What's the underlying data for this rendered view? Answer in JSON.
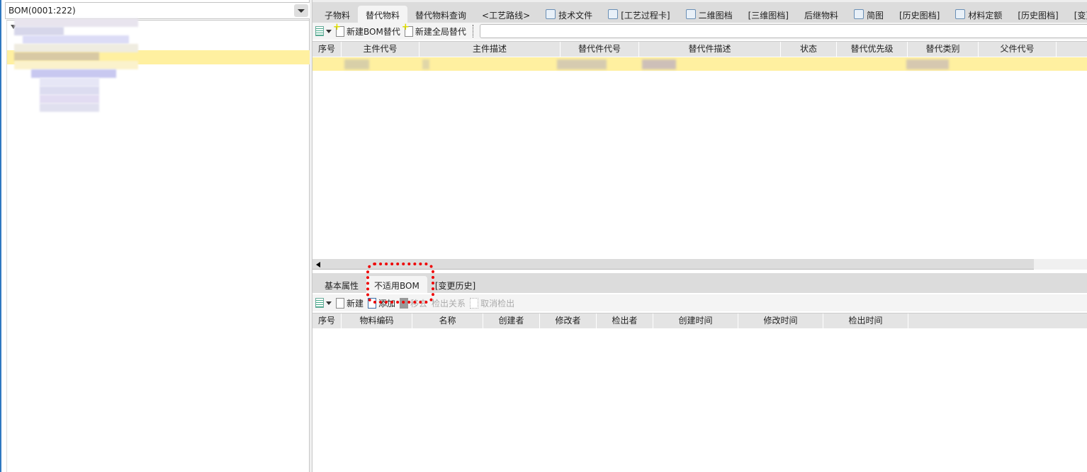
{
  "left": {
    "combo_value": "BOM(0001:222)"
  },
  "top_tabs": [
    "子物料",
    "替代物料",
    "替代物料查询",
    "<工艺路线>",
    "技术文件",
    "[工艺过程卡]",
    "二维图档",
    "[三维图档]",
    "后继物料",
    "简图",
    "[历史图档]",
    "材料定额",
    "[历史图档]",
    "[变更历史"
  ],
  "top_tab_icons": [
    "",
    "",
    "",
    "",
    "document-icon",
    "process-card-icon",
    "2d-drawing-icon",
    "",
    "",
    "sketch-icon",
    "",
    "material-quota-icon",
    "",
    ""
  ],
  "top_active": 1,
  "top_toolbar": {
    "new_bom_sub": "新建BOM替代",
    "new_global_sub": "新建全局替代"
  },
  "top_columns": [
    "序号",
    "主件代号",
    "主件描述",
    "替代件代号",
    "替代件描述",
    "状态",
    "替代优先级",
    "替代类别",
    "父件代号"
  ],
  "bottom_tabs": [
    "基本属性",
    "不适用BOM",
    "[变更历史]"
  ],
  "bottom_active": 1,
  "bottom_toolbar": {
    "new": "新建",
    "add": "添加",
    "remove": "移去",
    "checkout_rel": "检出关系",
    "cancel_checkout": "取消检出"
  },
  "bottom_columns": [
    "序号",
    "物料编码",
    "名称",
    "创建者",
    "修改者",
    "检出者",
    "创建时间",
    "修改时间",
    "检出时间"
  ],
  "colors": {
    "selection": "#fff0a0",
    "highlight": "#e00000"
  }
}
